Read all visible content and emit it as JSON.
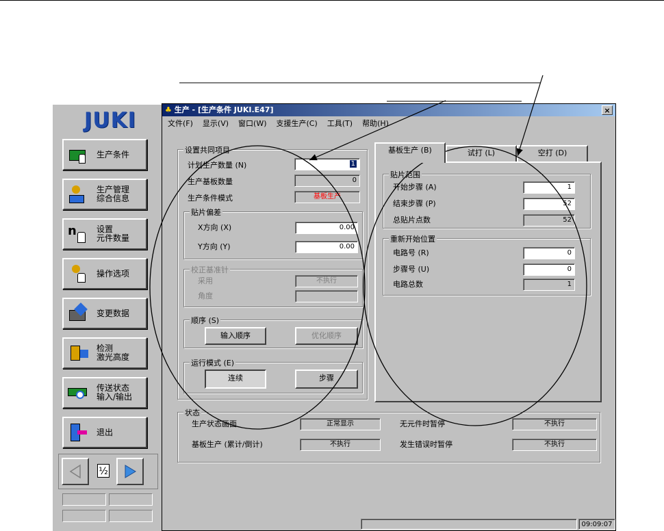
{
  "window": {
    "title": "生产 - [生产条件 JUKI.E47]",
    "close_glyph": "×"
  },
  "menu": [
    "文件(F)",
    "显示(V)",
    "窗口(W)",
    "支援生产(C)",
    "工具(T)",
    "帮助(H)"
  ],
  "sidebar": {
    "logo": "JUKI",
    "buttons": [
      {
        "label": "生产条件",
        "icon": "production-condition-icon"
      },
      {
        "label": "生产管理\n综合信息",
        "icon": "production-info-icon"
      },
      {
        "label": "设置\n元件数量",
        "icon": "component-count-icon"
      },
      {
        "label": "操作选项",
        "icon": "operation-option-icon"
      },
      {
        "label": "变更数据",
        "icon": "change-data-icon"
      },
      {
        "label": "检测\n激光高度",
        "icon": "laser-height-icon"
      },
      {
        "label": "传送状态\n输入/输出",
        "icon": "transport-io-icon"
      },
      {
        "label": "退出",
        "icon": "exit-icon"
      }
    ],
    "page_indicator": "½"
  },
  "common": {
    "group_title": "设置共同项目",
    "plan_qty_label": "计划生产数量 (N)",
    "plan_qty_value": "1",
    "board_qty_label": "生产基板数量",
    "board_qty_value": "0",
    "mode_label": "生产条件模式",
    "mode_value": "基板生产",
    "offset_group": "贴片偏差",
    "x_label": "X方向 (X)",
    "x_value": "0.00",
    "y_label": "Y方向 (Y)",
    "y_value": "0.00",
    "pin_group": "校正基准针",
    "use_label": "采用",
    "use_value": "不执行",
    "angle_label": "角度",
    "angle_value": "",
    "order_group": "顺序 (S)",
    "input_order": "输入顺序",
    "optimize_order": "优化顺序",
    "run_group": "运行模式 (E)",
    "continuous": "连续",
    "step": "步骤"
  },
  "tabs": [
    "基板生产 (B)",
    "试打 (L)",
    "空打 (D)"
  ],
  "mount_range": {
    "group_title": "贴片范围",
    "start_label": "开始步骤 (A)",
    "start_value": "1",
    "end_label": "结束步骤 (P)",
    "end_value": "52",
    "total_label": "总贴片点数",
    "total_value": "52"
  },
  "restart": {
    "group_title": "重新开始位置",
    "circuit_label": "电路号 (R)",
    "circuit_value": "0",
    "step_label": "步骤号 (U)",
    "step_value": "0",
    "total_label": "电路总数",
    "total_value": "1"
  },
  "status": {
    "group_title": "状态",
    "screen_label": "生产状态画面",
    "screen_value": "正常显示",
    "board_label": "基板生产 (累计/倒计)",
    "board_value": "不执行",
    "nocomp_label": "无元件时暂停",
    "nocomp_value": "不执行",
    "error_label": "发生错误时暂停",
    "error_value": "不执行"
  },
  "clock": "09:09:07",
  "colors": {
    "mode_value": "#ff0000",
    "title_start": "#0a246a",
    "title_end": "#a6caf0",
    "logo": "#1f4aa8"
  }
}
